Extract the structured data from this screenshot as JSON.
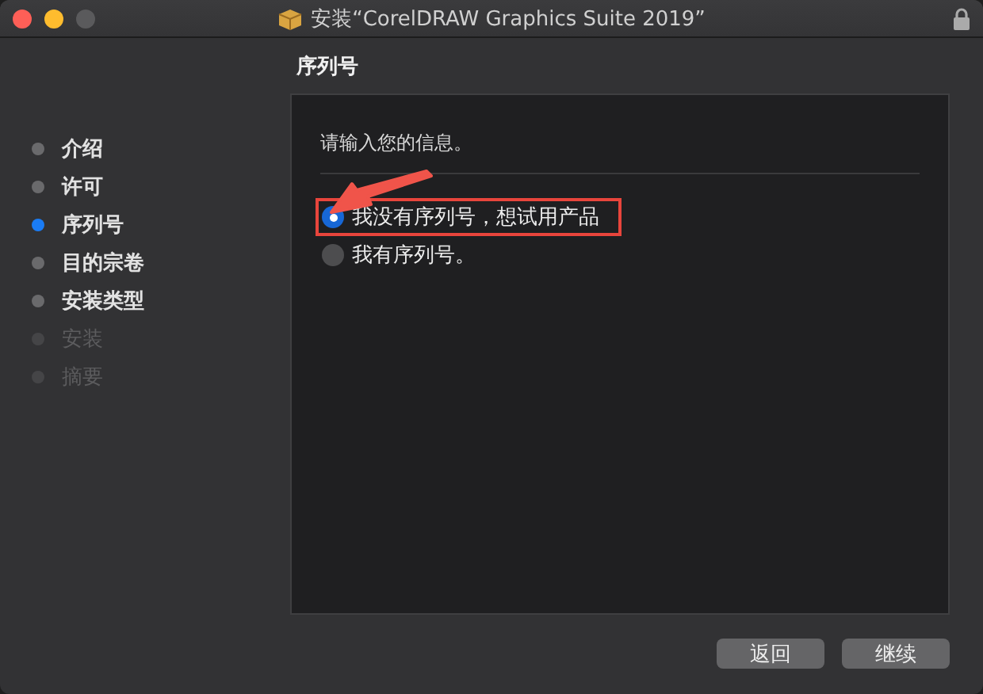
{
  "window": {
    "title": "安装“CorelDRAW Graphics Suite 2019”",
    "locked": true
  },
  "steps": [
    {
      "label": "介绍",
      "selected": false,
      "disabled": false
    },
    {
      "label": "许可",
      "selected": false,
      "disabled": false
    },
    {
      "label": "序列号",
      "selected": true,
      "disabled": false
    },
    {
      "label": "目的宗卷",
      "selected": false,
      "disabled": false
    },
    {
      "label": "安装类型",
      "selected": false,
      "disabled": false
    },
    {
      "label": "安装",
      "selected": false,
      "disabled": true
    },
    {
      "label": "摘要",
      "selected": false,
      "disabled": true
    }
  ],
  "heading": "序列号",
  "prompt": "请输入您的信息。",
  "options": [
    {
      "label": "我没有序列号，想试用产品",
      "selected": true,
      "highlighted": true
    },
    {
      "label": "我有序列号。",
      "selected": false,
      "highlighted": false
    }
  ],
  "buttons": [
    "返回",
    "继续"
  ]
}
